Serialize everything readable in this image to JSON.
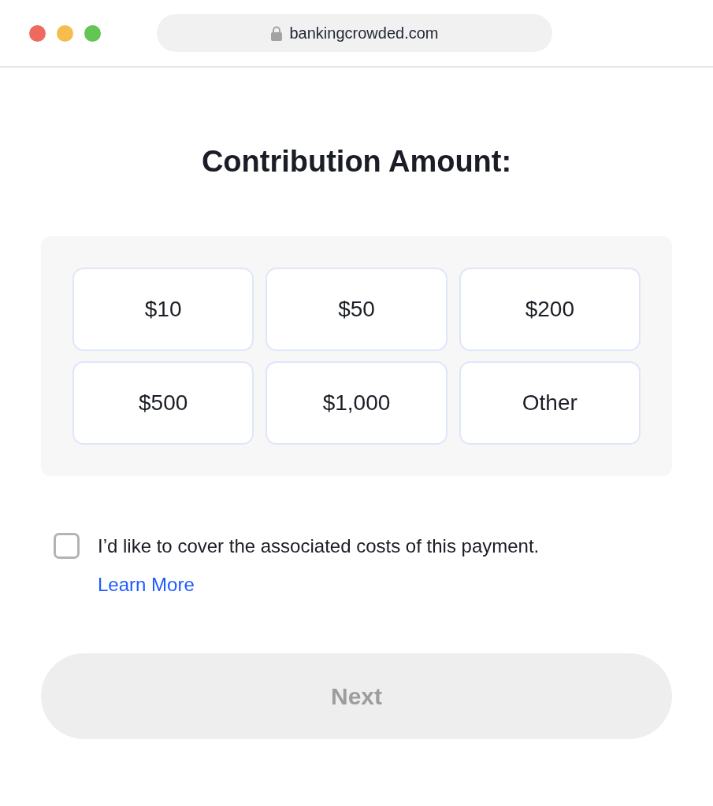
{
  "browser": {
    "window_controls": [
      {
        "color": "#ee6a5f"
      },
      {
        "color": "#f5bd4f"
      },
      {
        "color": "#62c554"
      }
    ],
    "address_bar": {
      "url": "bankingcrowded.com",
      "secure": true
    }
  },
  "title": "Contribution Amount:",
  "amounts": [
    {
      "label": "$10",
      "selected": false
    },
    {
      "label": "$50",
      "selected": false
    },
    {
      "label": "$200",
      "selected": false
    },
    {
      "label": "$500",
      "selected": false
    },
    {
      "label": "$1,000",
      "selected": false
    },
    {
      "label": "Other",
      "selected": false
    }
  ],
  "cover_costs": {
    "checked": false,
    "label": "I’d like to cover the associated costs of this payment.",
    "link": "Learn More"
  },
  "next_button": {
    "label": "Next",
    "disabled": true
  }
}
